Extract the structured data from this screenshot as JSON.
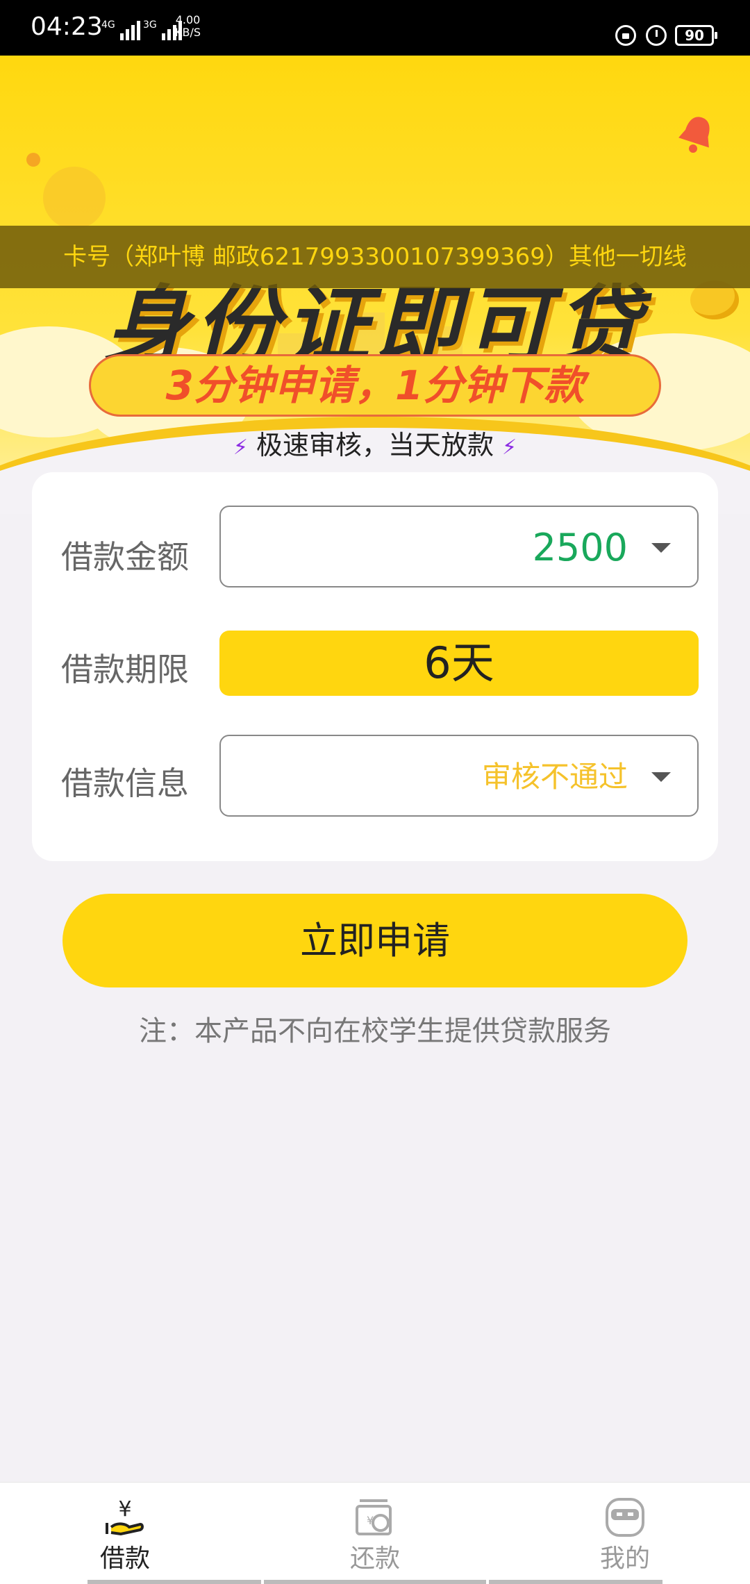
{
  "status_bar": {
    "time": "04:23",
    "network_1": "4G",
    "network_2": "3G",
    "speed_value": "4.00",
    "speed_unit": "KB/S",
    "battery": "90"
  },
  "banner": {
    "ticker": "卡号（郑叶博 邮政6217993300107399369）其他一切线",
    "headline": "身份证即可贷",
    "pill": "3分钟申请，1分钟下款",
    "subline": "极速审核，当天放款",
    "bolt_glyph": "⚡"
  },
  "form": {
    "amount_label": "借款金额",
    "amount_value": "2500",
    "amount_color": "#19a85b",
    "term_label": "借款期限",
    "term_value": "6天",
    "info_label": "借款信息",
    "info_value": "审核不通过",
    "info_color": "#f5c22b"
  },
  "actions": {
    "apply_label": "立即申请"
  },
  "note": "注：本产品不向在校学生提供贷款服务",
  "bottom_nav": {
    "items": [
      {
        "label": "借款",
        "icon": "loan-hand-yen-icon",
        "active": true
      },
      {
        "label": "还款",
        "icon": "repay-wallet-icon",
        "active": false
      },
      {
        "label": "我的",
        "icon": "profile-face-icon",
        "active": false
      }
    ],
    "active_color": "#222222",
    "inactive_color": "#999999"
  },
  "colors": {
    "brand_yellow": "#ffd60f",
    "ticker_text": "#ffd60f",
    "pill_text": "#f04f2a"
  }
}
